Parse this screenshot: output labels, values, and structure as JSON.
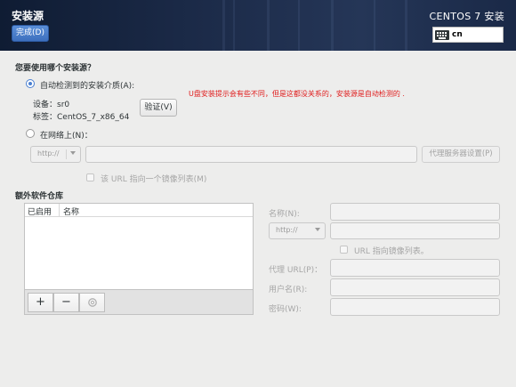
{
  "header": {
    "title": "安装源",
    "done_label": "完成(D)",
    "product": "CENTOS 7 安装",
    "keyboard_layout": "cn"
  },
  "question": "您要使用哪个安装源？",
  "auto_detect": {
    "label": "自动检测到的安装介质(A):",
    "selected": true,
    "device_label": "设备：",
    "device_value": "sr0",
    "tag_label": "标签：",
    "tag_value": "CentOS_7_x86_64",
    "verify_label": "验证(V)"
  },
  "annotation": "U盘安装提示会有些不同，但是这都没关系的，安装源是自动检测的 .",
  "network": {
    "label": "在网络上(N)：",
    "selected": false,
    "protocol": "http://",
    "url_value": "",
    "proxy_button": "代理服务器设置(P)",
    "mirror_checkbox_label": "该 URL 指向一个镜像列表(M)"
  },
  "repos": {
    "section_title": "额外软件仓库",
    "columns": [
      "已启用",
      "名称"
    ],
    "rows": [],
    "add_label": "+",
    "remove_label": "−",
    "reset_icon": "reset-icon"
  },
  "repo_details": {
    "name_label": "名称(N):",
    "protocol": "http://",
    "mirror_label": "URL 指向镜像列表。",
    "proxy_url_label": "代理 URL(P)：",
    "username_label": "用户名(R):",
    "password_label": "密码(W):"
  },
  "colors": {
    "header_bg": "#1c2b49",
    "accent": "#4a7fd0",
    "annotation": "#e01b1b",
    "page_bg": "#ededec"
  }
}
